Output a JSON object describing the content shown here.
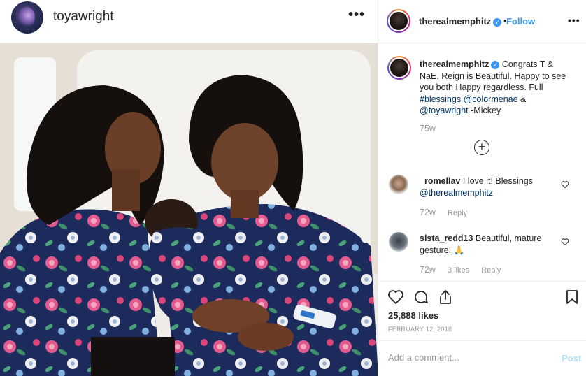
{
  "post": {
    "author": "toyawright",
    "more_icon": "more-dots-icon",
    "photo_description_icon": "photo"
  },
  "side": {
    "header": {
      "username": "therealmemphitz",
      "separator": "•",
      "follow_label": "Follow",
      "verified_icon": "verified-badge-icon"
    },
    "caption": {
      "username": "therealmemphitz",
      "text_1": "Congrats T & NaE. Reign is Beautiful. Happy to see you both Happy regardless. Full ",
      "hashtag": "#blessings",
      "mention_1": "@colormenae",
      "amp": " & ",
      "mention_2": "@toyawright",
      "text_2": " -Mickey",
      "time": "75w"
    },
    "comments": [
      {
        "username": "_romellav",
        "text": "I love it! Blessings ",
        "mention": "@therealmemphitz",
        "time": "72w",
        "reply": "Reply"
      },
      {
        "username": "sista_redd13",
        "text": "Beautiful, mature gesture! 🙏",
        "time": "72w",
        "likes": "3 likes",
        "reply": "Reply"
      }
    ],
    "likes": "25,888 likes",
    "date": "FEBRUARY 12, 2018",
    "add_comment_placeholder": "Add a comment...",
    "post_label": "Post"
  },
  "colors": {
    "link_blue": "#3897f0",
    "mention": "#003569",
    "muted": "#999999",
    "post_disabled": "#b2dffc"
  }
}
